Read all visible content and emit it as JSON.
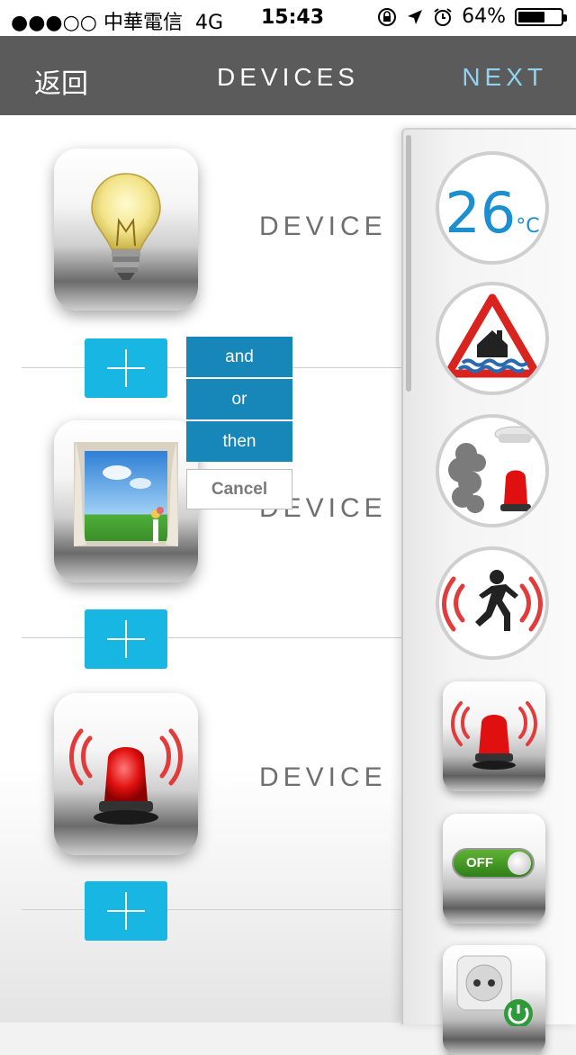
{
  "status_bar": {
    "carrier": "●●●○○ 中華電信",
    "network": "4G",
    "time": "15:43",
    "battery": "64%",
    "battery_level": 0.64
  },
  "navbar": {
    "back_label": "返回",
    "title": "DEVICES",
    "next_label": "NEXT",
    "colors": {
      "bar": "#5b5b5b",
      "next": "#8fd3f0"
    }
  },
  "devices": [
    {
      "label": "DEVICE",
      "icon": "light-bulb-icon"
    },
    {
      "label": "DEVICE",
      "icon": "window-icon"
    },
    {
      "label": "DEVICE",
      "icon": "siren-icon"
    }
  ],
  "condition_menu": {
    "options": [
      "and",
      "or",
      "then"
    ],
    "cancel_label": "Cancel",
    "color": "#1687b8"
  },
  "side_panel": {
    "temperature_value": "26",
    "temperature_unit": "°C",
    "toggle_label": "OFF",
    "icons": [
      "temperature-icon",
      "flood-warning-icon",
      "smoke-detector-icon",
      "motion-sensor-icon",
      "siren-icon",
      "off-switch-icon",
      "power-outlet-icon"
    ]
  },
  "accent_color": "#18b6e2"
}
